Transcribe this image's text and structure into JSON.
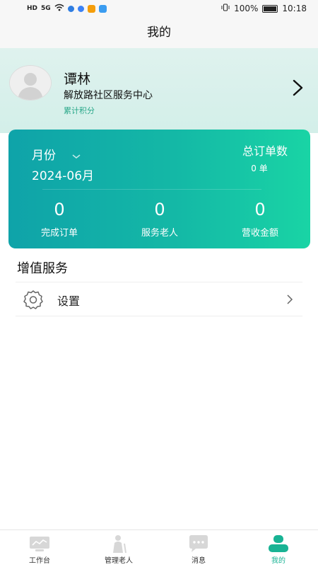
{
  "status_bar": {
    "left_text": "HD",
    "signal_text": "5G",
    "battery": "100%",
    "time": "10:18"
  },
  "nav": {
    "title": "我的"
  },
  "profile": {
    "name": "谭林",
    "organization": "解放路社区服务中心",
    "points_label": "累计积分"
  },
  "summary_card": {
    "month_label": "月份",
    "month_value": "2024-06月",
    "total_orders_label": "总订单数",
    "total_orders_value": "0 单",
    "stats": [
      {
        "value": "0",
        "label": "完成订单"
      },
      {
        "value": "0",
        "label": "服务老人"
      },
      {
        "value": "0",
        "label": "营收金额"
      }
    ]
  },
  "value_added": {
    "title": "增值服务",
    "items": [
      {
        "label": "设置",
        "icon": "gear-icon"
      }
    ]
  },
  "tabbar": {
    "items": [
      {
        "label": "工作台",
        "icon": "monitor-icon"
      },
      {
        "label": "管理老人",
        "icon": "elderly-icon"
      },
      {
        "label": "消息",
        "icon": "chat-bubble-icon"
      },
      {
        "label": "我的",
        "icon": "user-icon"
      }
    ],
    "active_index": 3
  },
  "colors": {
    "accent": "#18b394",
    "card_gradient_start": "#0fa3a9",
    "card_gradient_end": "#19d4a5",
    "profile_bg": "#d8f0eb"
  }
}
